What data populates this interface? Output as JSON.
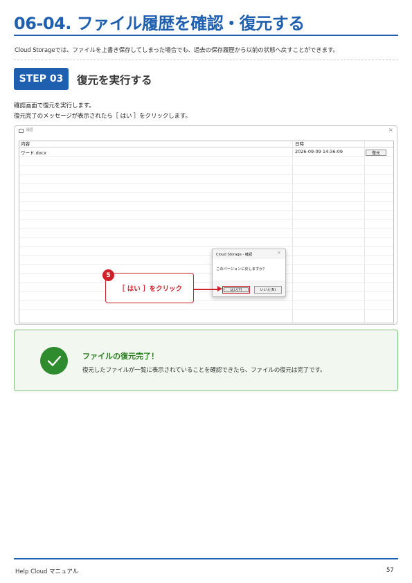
{
  "header": {
    "title": "06-04. ファイル履歴を確認・復元する",
    "intro": "Cloud Storageでは、ファイルを上書き保存してしまった場合でも、過去の保存履歴から以前の状態へ戻すことができます。"
  },
  "step": {
    "badge": "STEP 03",
    "title": "復元を実行する",
    "line1": "確認画面で復元を実行します。",
    "line2": "復元完了のメッセージが表示されたら［ はい ］をクリックします。"
  },
  "screenshot": {
    "window_title": "履歴",
    "close_glyph": "×",
    "columns": [
      "内容",
      "日時"
    ],
    "rows": [
      {
        "name": "ワード.docx",
        "datetime": "2026-09-09 14:36:09",
        "action": "復元"
      }
    ],
    "dialog": {
      "title": "Cloud Storage - 確認",
      "close_glyph": "×",
      "message": "このバージョンに戻しますか？",
      "yes": "はい(Y)",
      "no": "いいえ(N)"
    },
    "callout": {
      "number": "5",
      "text": "［ はい ］をクリック",
      "color": "#d0202a"
    }
  },
  "success": {
    "title": "ファイルの復元完了！",
    "description": "復元したファイルが一覧に表示されていることを確認できたら、ファイルの復元は完了です。",
    "icon": "check-icon"
  },
  "footer": {
    "left": "Help Cloud マニュアル",
    "page": "57"
  },
  "colors": {
    "primary": "#1f5fb0",
    "accent_red": "#d0202a",
    "success_green": "#2e8b2e"
  }
}
